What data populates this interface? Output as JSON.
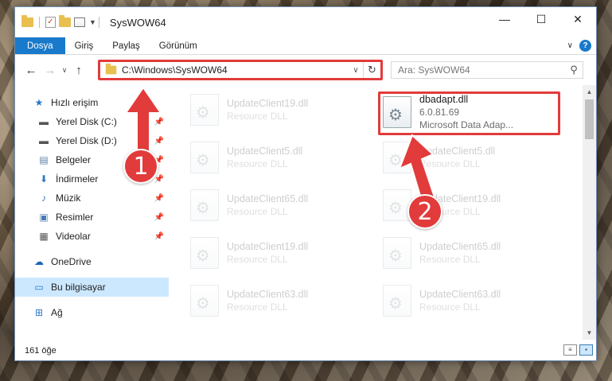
{
  "window": {
    "title": "SysWOW64",
    "controls": {
      "minimize": "—",
      "maximize": "☐",
      "close": "✕"
    }
  },
  "ribbon": {
    "tabs": [
      "Dosya",
      "Giriş",
      "Paylaş",
      "Görünüm"
    ],
    "expand_glyph": "∨",
    "help_glyph": "?"
  },
  "address": {
    "path": "C:\\Windows\\SysWOW64",
    "search_placeholder": "Ara: SysWOW64"
  },
  "nav_pane": {
    "quick_access": "Hızlı erişim",
    "items": [
      {
        "label": "Yerel Disk (C:)",
        "icon": "drive-icon"
      },
      {
        "label": "Yerel Disk (D:)",
        "icon": "drive-icon"
      },
      {
        "label": "Belgeler",
        "icon": "documents-icon"
      },
      {
        "label": "İndirmeler",
        "icon": "downloads-icon"
      },
      {
        "label": "Müzik",
        "icon": "music-icon"
      },
      {
        "label": "Resimler",
        "icon": "pictures-icon"
      },
      {
        "label": "Videolar",
        "icon": "videos-icon"
      }
    ],
    "onedrive": "OneDrive",
    "this_pc": "Bu bilgisayar",
    "network": "Ağ"
  },
  "files": {
    "highlighted": {
      "name": "dbadapt.dll",
      "version": "6.0.81.69",
      "description": "Microsoft Data Adap..."
    },
    "left_column": [
      {
        "name": "UpdateClient19.dll",
        "type": "Resource DLL"
      },
      {
        "name": "UpdateClient5.dll",
        "type": "Resource DLL"
      },
      {
        "name": "UpdateClient65.dll",
        "type": "Resource DLL"
      },
      {
        "name": "UpdateClient19.dll",
        "type": "Resource DLL"
      },
      {
        "name": "UpdateClient63.dll",
        "type": "Resource DLL"
      }
    ],
    "right_column": [
      {
        "name": "UpdateClient5.dll",
        "type": "Resource DLL"
      },
      {
        "name": "UpdateClient19.dll",
        "type": "Resource DLL"
      },
      {
        "name": "UpdateClient65.dll",
        "type": "Resource DLL"
      },
      {
        "name": "UpdateClient63.dll",
        "type": "Resource DLL"
      }
    ]
  },
  "status": {
    "count": "161 öğe"
  },
  "annotations": {
    "step1": "1",
    "step2": "2",
    "color": "#e23b3b"
  }
}
